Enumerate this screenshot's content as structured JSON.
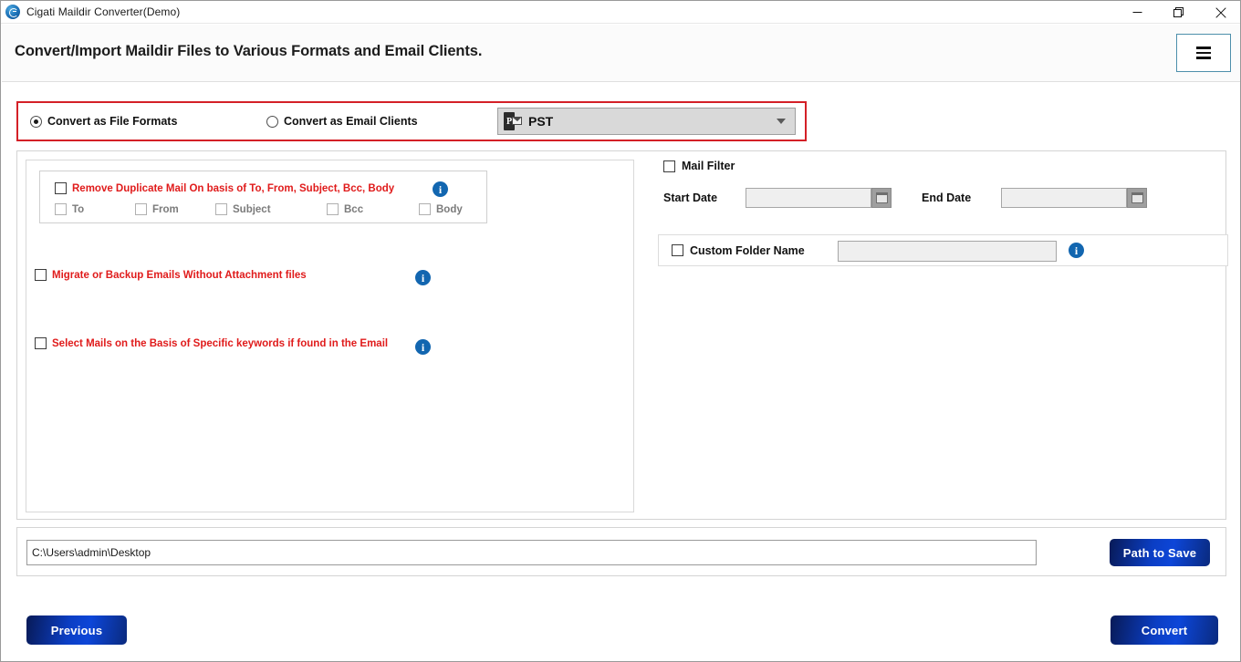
{
  "window": {
    "title": "Cigati Maildir Converter(Demo)",
    "app_icon": "cigati-logo-icon",
    "controls": [
      {
        "name": "minimize",
        "icon": "minimize-icon"
      },
      {
        "name": "maximize",
        "icon": "restore-icon"
      },
      {
        "name": "close",
        "icon": "close-icon"
      }
    ]
  },
  "header": {
    "title": "Convert/Import Maildir Files to Various Formats and Email Clients.",
    "menu_icon": "hamburger-menu-icon"
  },
  "mode_row": {
    "accent_border_color": "#d42027",
    "options": [
      {
        "label": "Convert as File Formats",
        "selected": true
      },
      {
        "label": "Convert as Email Clients",
        "selected": false
      }
    ],
    "format_select": {
      "value": "PST",
      "icon": "pst-file-icon",
      "caret": "chevron-down-icon"
    }
  },
  "left_panel": {
    "duplicate": {
      "label": "Remove Duplicate Mail On basis of To, From, Subject, Bcc, Body",
      "checked": false,
      "info_icon": "info-icon",
      "sub_options": [
        {
          "label": "To",
          "checked": false,
          "disabled": true
        },
        {
          "label": "From",
          "checked": false,
          "disabled": true
        },
        {
          "label": "Subject",
          "checked": false,
          "disabled": true
        },
        {
          "label": "Bcc",
          "checked": false,
          "disabled": true
        },
        {
          "label": "Body",
          "checked": false,
          "disabled": true
        }
      ]
    },
    "options": [
      {
        "label": "Migrate or Backup Emails Without Attachment files",
        "checked": false,
        "info_icon": "info-icon"
      },
      {
        "label": "Select Mails on the Basis of Specific keywords if found in the Email",
        "checked": false,
        "info_icon": "info-icon"
      }
    ]
  },
  "right_panel": {
    "mail_filter": {
      "label": "Mail Filter",
      "checked": false
    },
    "start_date": {
      "label": "Start Date",
      "value": "",
      "picker_icon": "calendar-icon"
    },
    "end_date": {
      "label": "End Date",
      "value": "",
      "picker_icon": "calendar-icon"
    },
    "custom_folder": {
      "label": "Custom Folder Name",
      "checked": false,
      "value": "",
      "info_icon": "info-icon"
    }
  },
  "path_bar": {
    "path_value": "C:\\Users\\admin\\Desktop",
    "save_button": "Path to Save"
  },
  "footer": {
    "previous_button": "Previous",
    "convert_button": "Convert"
  },
  "colors": {
    "accent_red": "#d42027",
    "label_red": "#e01b1b",
    "info_blue": "#1266b0",
    "button_blue": "#0b3ec4"
  }
}
